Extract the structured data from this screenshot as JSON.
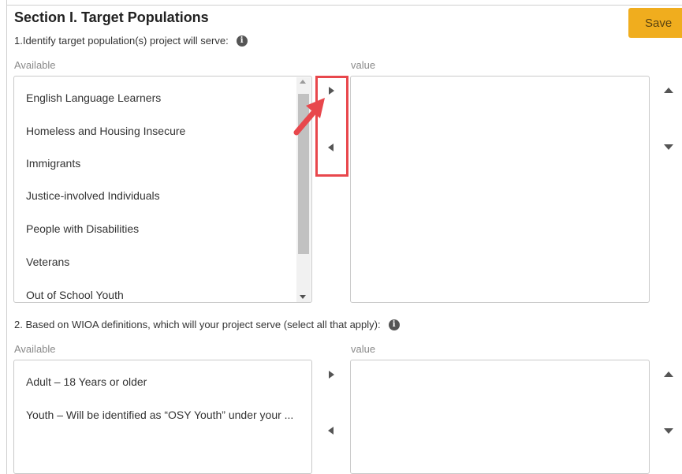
{
  "section": {
    "title": "Section I. Target Populations",
    "save_label": "Save"
  },
  "question1": {
    "text": "1.Identify target population(s) project will serve:",
    "available_label": "Available",
    "value_label": "value",
    "items": [
      "English Language Learners",
      "Homeless and Housing Insecure",
      "Immigrants",
      "Justice-involved Individuals",
      "People with Disabilities",
      "Veterans",
      "Out of School Youth"
    ]
  },
  "question2": {
    "text": "2. Based on WIOA definitions, which will your project serve (select all that apply):",
    "available_label": "Available",
    "value_label": "value",
    "items": [
      "Adult – 18 Years or older",
      "Youth – Will be identified as “OSY Youth” under your ..."
    ]
  },
  "icons": {
    "info": "info-icon",
    "move_right": "triangle-right-icon",
    "move_left": "triangle-left-icon",
    "move_up": "triangle-up-icon",
    "move_down": "triangle-down-icon"
  },
  "colors": {
    "accent": "#f0ad1e",
    "annotation": "#e8474c"
  }
}
